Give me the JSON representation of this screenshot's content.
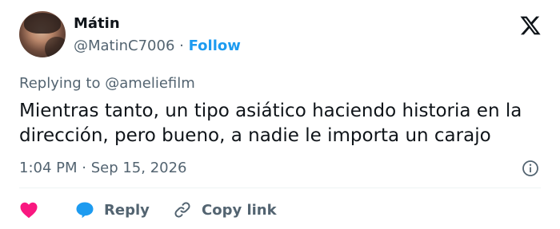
{
  "tweet": {
    "author": {
      "name": "Mátin",
      "handle": "@MatinC7006"
    },
    "separator": "·",
    "follow_label": "Follow",
    "replying_to_prefix": "Replying to",
    "replying_to_mention": "@ameliefilm",
    "text": "Mientras tanto, un tipo asiático haciendo historia en la dirección, pero bueno, a nadie le importa un carajo",
    "timestamp": "1:04 PM · Sep 15, 2026"
  },
  "actions": {
    "reply_label": "Reply",
    "copy_link_label": "Copy link"
  },
  "icons": {
    "brand": "x-logo-icon",
    "info": "info-icon",
    "like": "heart-icon",
    "reply": "reply-bubble-icon",
    "copy": "link-icon"
  },
  "colors": {
    "accent": "#1d9bf0",
    "like": "#f91880",
    "muted": "#536471",
    "text": "#0f1419"
  }
}
